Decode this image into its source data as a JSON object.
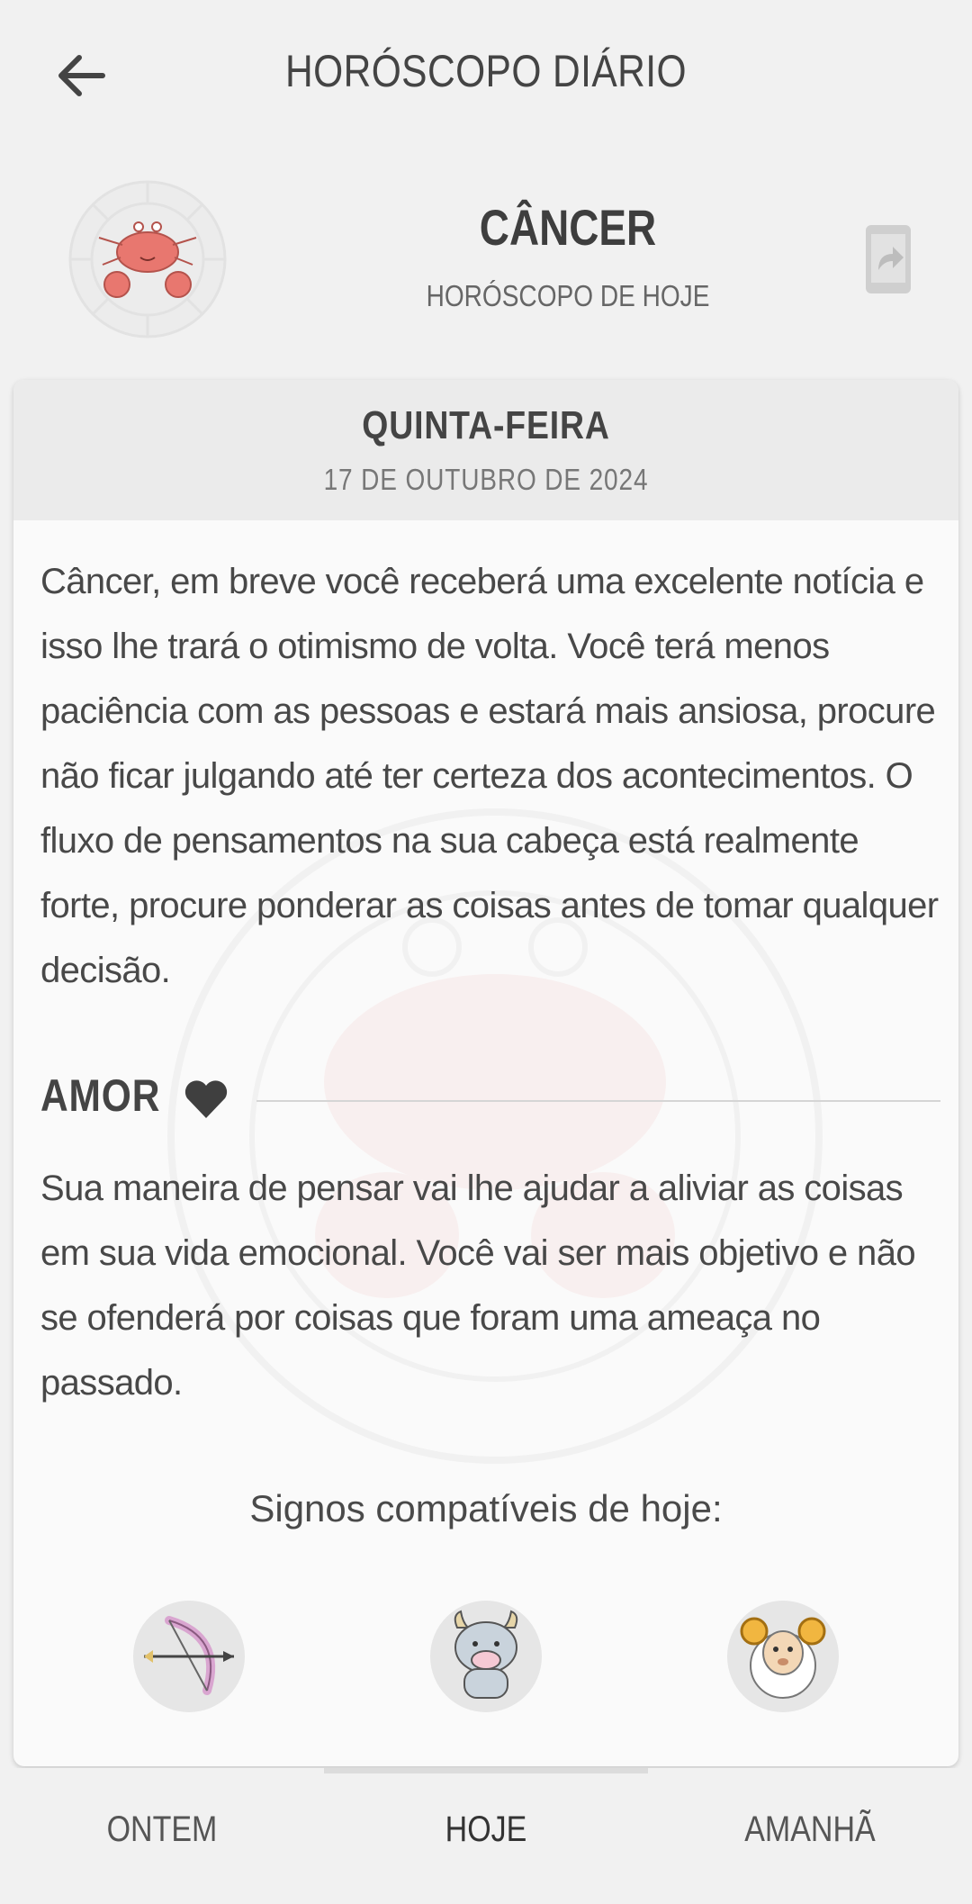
{
  "header": {
    "title": "HORÓSCOPO DIÁRIO"
  },
  "sign": {
    "name": "CÂNCER",
    "subtitle": "HORÓSCOPO DE HOJE"
  },
  "card": {
    "weekday": "QUINTA-FEIRA",
    "date": "17 DE OUTUBRO DE 2024",
    "text": "Câncer, em breve você receberá uma excelente notícia e isso lhe trará o otimismo de volta. Você terá menos paciência com as pessoas e estará mais ansiosa, procure não ficar julgando até ter certeza dos acontecimentos. O fluxo de pensamentos na sua cabeça está realmente forte, procure ponderar as coisas antes de tomar qualquer decisão.",
    "love": {
      "title": "AMOR",
      "text": "Sua maneira de pensar vai lhe ajudar a aliviar as coisas em sua vida emocional. Você vai ser mais objetivo e não se ofenderá por coisas que foram uma ameaça no passado."
    },
    "compatible": {
      "title": "Signos compatíveis de hoje:",
      "signs": [
        {
          "icon": "sagittarius-bow-icon"
        },
        {
          "icon": "taurus-bull-icon"
        },
        {
          "icon": "aries-ram-icon"
        }
      ]
    }
  },
  "nav": {
    "yesterday": "ONTEM",
    "today": "HOJE",
    "tomorrow": "AMANHÃ",
    "active": "today"
  },
  "colors": {
    "background": "#f1f1f1",
    "card": "#fafafa",
    "accent_crab": "#e8726a"
  }
}
